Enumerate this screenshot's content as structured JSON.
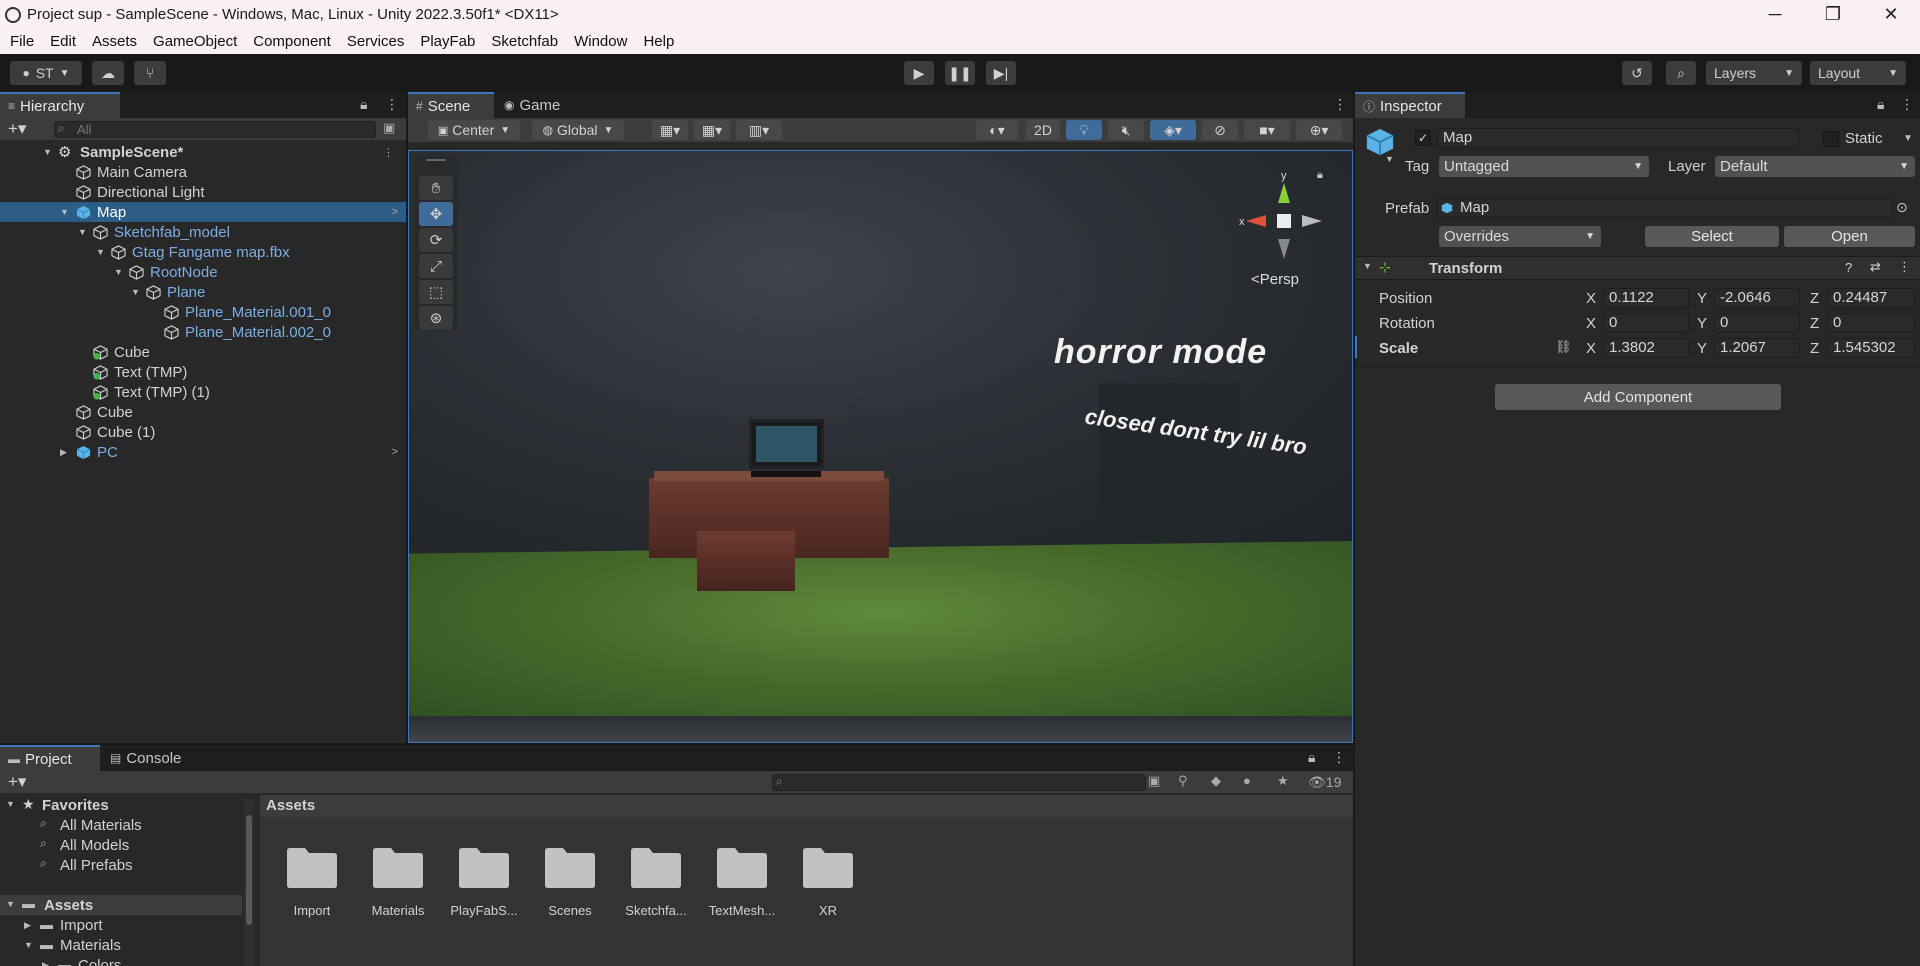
{
  "window": {
    "title": "Project sup - SampleScene - Windows, Mac, Linux - Unity 2022.3.50f1* <DX11>",
    "controls": [
      "─",
      "❐",
      "✕"
    ]
  },
  "menu": [
    "File",
    "Edit",
    "Assets",
    "GameObject",
    "Component",
    "Services",
    "PlayFab",
    "Sketchfab",
    "Window",
    "Help"
  ],
  "toolbar": {
    "account": "ST",
    "layers": "Layers",
    "layout": "Layout"
  },
  "hierarchy": {
    "tab": "Hierarchy",
    "search_placeholder": "All",
    "items": [
      {
        "label": "SampleScene*",
        "depth": 0,
        "type": "scene"
      },
      {
        "label": "Main Camera",
        "depth": 1,
        "type": "object"
      },
      {
        "label": "Directional Light",
        "depth": 1,
        "type": "object"
      },
      {
        "label": "Map",
        "depth": 1,
        "type": "prefab-root",
        "selected": true
      },
      {
        "label": "Sketchfab_model",
        "depth": 2,
        "type": "prefab"
      },
      {
        "label": "Gtag Fangame map.fbx",
        "depth": 3,
        "type": "prefab"
      },
      {
        "label": "RootNode",
        "depth": 4,
        "type": "prefab"
      },
      {
        "label": "Plane",
        "depth": 5,
        "type": "prefab"
      },
      {
        "label": "Plane_Material.001_0",
        "depth": 6,
        "type": "prefab"
      },
      {
        "label": "Plane_Material.002_0",
        "depth": 6,
        "type": "prefab"
      },
      {
        "label": "Cube",
        "depth": 2,
        "type": "added"
      },
      {
        "label": "Text (TMP)",
        "depth": 2,
        "type": "added"
      },
      {
        "label": "Text (TMP) (1)",
        "depth": 2,
        "type": "added"
      },
      {
        "label": "Cube",
        "depth": 1,
        "type": "object"
      },
      {
        "label": "Cube (1)",
        "depth": 1,
        "type": "object"
      },
      {
        "label": "PC",
        "depth": 1,
        "type": "prefab-root"
      }
    ]
  },
  "scene": {
    "tabs": [
      "Scene",
      "Game"
    ],
    "pivot": "Center",
    "space": "Global",
    "mode2d": "2D",
    "persp": "Persp",
    "gizmo_axes": {
      "x": "x",
      "y": "y"
    },
    "texts": {
      "horror": "horror mode",
      "closed": "closed dont try lil bro"
    }
  },
  "inspector": {
    "tab": "Inspector",
    "object_name": "Map",
    "static_label": "Static",
    "tag_label": "Tag",
    "tag_value": "Untagged",
    "layer_label": "Layer",
    "layer_value": "Default",
    "prefab_label": "Prefab",
    "prefab_value": "Map",
    "overrides": "Overrides",
    "select": "Select",
    "open": "Open",
    "transform": {
      "title": "Transform",
      "position": {
        "label": "Position",
        "x": "0.1122",
        "y": "-2.0646",
        "z": "0.24487"
      },
      "rotation": {
        "label": "Rotation",
        "x": "0",
        "y": "0",
        "z": "0"
      },
      "scale": {
        "label": "Scale",
        "x": "1.3802",
        "y": "1.2067",
        "z": "1.545302"
      }
    },
    "add_component": "Add Component"
  },
  "project": {
    "tabs": [
      "Project",
      "Console"
    ],
    "hidden_count": "19",
    "favorites": {
      "label": "Favorites",
      "items": [
        "All Materials",
        "All Models",
        "All Prefabs"
      ]
    },
    "assets_tree": {
      "label": "Assets",
      "items": [
        "Import",
        "Materials",
        "Colors"
      ]
    },
    "breadcrumb": "Assets",
    "folders": [
      "Import",
      "Materials",
      "PlayFabS...",
      "Scenes",
      "Sketchfa...",
      "TextMesh...",
      "XR"
    ]
  },
  "colors": {
    "accent": "#3a79bb",
    "selection": "#2c5d87",
    "prefab_text": "#7baee6"
  }
}
